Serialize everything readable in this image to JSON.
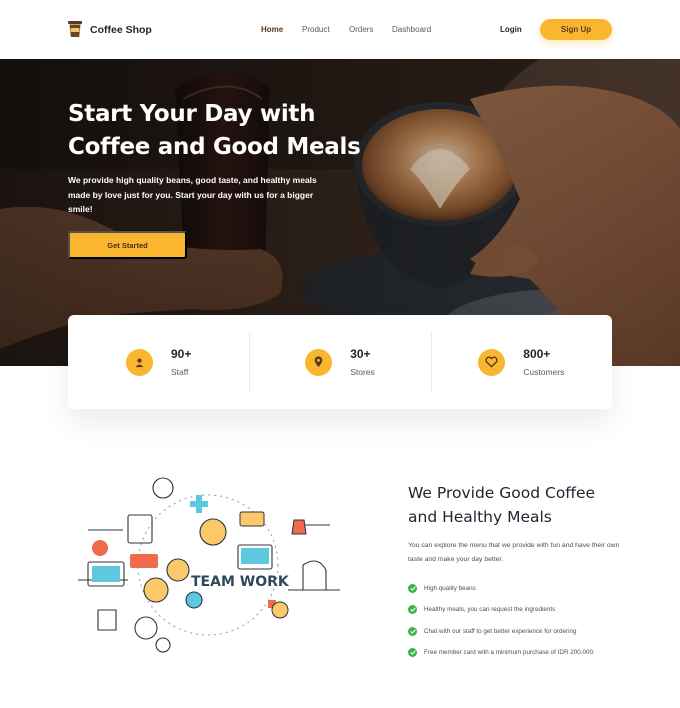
{
  "brand": {
    "name": "Coffee Shop",
    "icon": "coffee-cup-icon"
  },
  "nav": {
    "links": [
      {
        "label": "Home",
        "active": true
      },
      {
        "label": "Product",
        "active": false
      },
      {
        "label": "Orders",
        "active": false
      },
      {
        "label": "Dashboard",
        "active": false
      }
    ],
    "login_label": "Login",
    "signup_label": "Sign Up"
  },
  "hero": {
    "title": "Start Your Day with Coffee and Good Meals",
    "subtitle": "We provide high quality beans, good taste, and healthy meals made by love just for you. Start your day with us for a bigger smile!",
    "cta_label": "Get Started"
  },
  "stats": [
    {
      "value": "90+",
      "label": "Staff",
      "icon": "person-icon"
    },
    {
      "value": "30+",
      "label": "Stores",
      "icon": "location-pin-icon"
    },
    {
      "value": "800+",
      "label": "Customers",
      "icon": "heart-icon"
    }
  ],
  "feature": {
    "illustration_text": "TEAM WORK",
    "title": "We Provide Good Coffee and Healthy Meals",
    "description": "You can explore the menu that we provide with fun and have their own taste and make your day better.",
    "items": [
      "High quality beans",
      "Healthy meals, you can request the ingredients",
      "Chat with our staff to get better experience for ordering",
      "Free member card with a minimum purchase of IDR 200.000."
    ]
  },
  "colors": {
    "accent": "#fbb630",
    "brand_brown": "#5a3a1e",
    "check_green": "#3bb54a",
    "text_dark": "#1f2430"
  }
}
